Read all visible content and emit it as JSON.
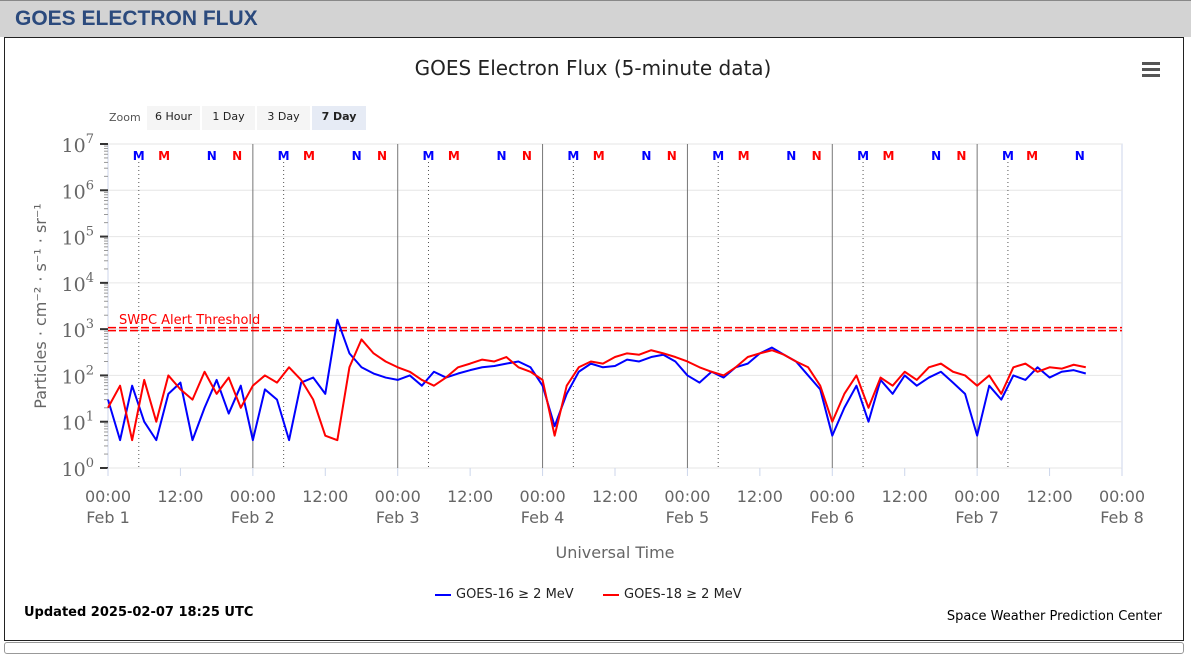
{
  "header": {
    "title": "GOES ELECTRON FLUX"
  },
  "zoom": {
    "label": "Zoom",
    "buttons": [
      "6 Hour",
      "1 Day",
      "3 Day",
      "7 Day"
    ],
    "selected": "7 Day"
  },
  "legend": [
    "GOES-16 ≥ 2 MeV",
    "GOES-18 ≥ 2 MeV"
  ],
  "footer": {
    "updated": "Updated 2025-02-07 18:25 UTC",
    "credit": "Space Weather Prediction Center"
  },
  "chart_data": {
    "type": "line",
    "title": "GOES Electron Flux (5-minute data)",
    "xlabel": "Universal Time",
    "ylabel": "Particles · cm⁻² · s⁻¹ · sr⁻¹",
    "yscale": "log",
    "ylim": [
      1,
      10000000
    ],
    "ytick_exponents": [
      0,
      1,
      2,
      3,
      4,
      5,
      6,
      7
    ],
    "xlim_hours": [
      0,
      168
    ],
    "xticks": [
      {
        "hour": 0,
        "time": "00:00",
        "date": "Feb 1"
      },
      {
        "hour": 12,
        "time": "12:00",
        "date": ""
      },
      {
        "hour": 24,
        "time": "00:00",
        "date": "Feb 2"
      },
      {
        "hour": 36,
        "time": "12:00",
        "date": ""
      },
      {
        "hour": 48,
        "time": "00:00",
        "date": "Feb 3"
      },
      {
        "hour": 60,
        "time": "12:00",
        "date": ""
      },
      {
        "hour": 72,
        "time": "00:00",
        "date": "Feb 4"
      },
      {
        "hour": 84,
        "time": "12:00",
        "date": ""
      },
      {
        "hour": 96,
        "time": "00:00",
        "date": "Feb 5"
      },
      {
        "hour": 108,
        "time": "12:00",
        "date": ""
      },
      {
        "hour": 120,
        "time": "00:00",
        "date": "Feb 6"
      },
      {
        "hour": 132,
        "time": "12:00",
        "date": ""
      },
      {
        "hour": 144,
        "time": "00:00",
        "date": "Feb 7"
      },
      {
        "hour": 156,
        "time": "12:00",
        "date": ""
      },
      {
        "hour": 168,
        "time": "00:00",
        "date": "Feb 8"
      }
    ],
    "threshold": {
      "label": "SWPC Alert Threshold",
      "value": 1000,
      "color": "#ff0000"
    },
    "step_hours": 2,
    "series": [
      {
        "name": "GOES-16 ≥ 2 MeV",
        "color": "#0000ff",
        "values": [
          30,
          4,
          60,
          10,
          4,
          40,
          70,
          4,
          20,
          80,
          15,
          60,
          4,
          50,
          30,
          4,
          70,
          90,
          40,
          1600,
          300,
          150,
          110,
          90,
          80,
          100,
          60,
          120,
          90,
          110,
          130,
          150,
          160,
          180,
          200,
          150,
          60,
          8,
          40,
          120,
          180,
          150,
          160,
          220,
          200,
          250,
          280,
          200,
          100,
          70,
          120,
          90,
          150,
          180,
          300,
          400,
          280,
          200,
          100,
          50,
          5,
          20,
          60,
          10,
          80,
          40,
          100,
          60,
          90,
          120,
          70,
          40,
          5,
          60,
          30,
          100,
          80,
          150,
          90,
          120,
          130,
          110
        ]
      },
      {
        "name": "GOES-18 ≥ 2 MeV",
        "color": "#ff0000",
        "values": [
          20,
          60,
          4,
          80,
          10,
          100,
          50,
          30,
          120,
          40,
          90,
          20,
          60,
          100,
          70,
          150,
          80,
          30,
          5,
          4,
          150,
          600,
          300,
          200,
          150,
          120,
          80,
          60,
          90,
          150,
          180,
          220,
          200,
          250,
          150,
          120,
          80,
          5,
          60,
          150,
          200,
          180,
          250,
          300,
          280,
          350,
          300,
          250,
          200,
          150,
          120,
          100,
          150,
          250,
          300,
          350,
          280,
          200,
          150,
          60,
          10,
          40,
          100,
          20,
          90,
          60,
          120,
          80,
          150,
          180,
          120,
          100,
          60,
          100,
          40,
          150,
          180,
          120,
          150,
          140,
          170,
          150
        ]
      }
    ],
    "markers": [
      {
        "label": "M",
        "sat": 0,
        "hour": 5.1
      },
      {
        "label": "M",
        "sat": 1,
        "hour": 9.3
      },
      {
        "label": "N",
        "sat": 0,
        "hour": 17.2
      },
      {
        "label": "N",
        "sat": 1,
        "hour": 21.4
      },
      {
        "label": "M",
        "sat": 0,
        "hour": 29.1
      },
      {
        "label": "M",
        "sat": 1,
        "hour": 33.3
      },
      {
        "label": "N",
        "sat": 0,
        "hour": 41.2
      },
      {
        "label": "N",
        "sat": 1,
        "hour": 45.4
      },
      {
        "label": "M",
        "sat": 0,
        "hour": 53.1
      },
      {
        "label": "M",
        "sat": 1,
        "hour": 57.3
      },
      {
        "label": "N",
        "sat": 0,
        "hour": 65.2
      },
      {
        "label": "N",
        "sat": 1,
        "hour": 69.4
      },
      {
        "label": "M",
        "sat": 0,
        "hour": 77.1
      },
      {
        "label": "M",
        "sat": 1,
        "hour": 81.3
      },
      {
        "label": "N",
        "sat": 0,
        "hour": 89.2
      },
      {
        "label": "N",
        "sat": 1,
        "hour": 93.4
      },
      {
        "label": "M",
        "sat": 0,
        "hour": 101.1
      },
      {
        "label": "M",
        "sat": 1,
        "hour": 105.3
      },
      {
        "label": "N",
        "sat": 0,
        "hour": 113.2
      },
      {
        "label": "N",
        "sat": 1,
        "hour": 117.4
      },
      {
        "label": "M",
        "sat": 0,
        "hour": 125.1
      },
      {
        "label": "M",
        "sat": 1,
        "hour": 129.3
      },
      {
        "label": "N",
        "sat": 0,
        "hour": 137.2
      },
      {
        "label": "N",
        "sat": 1,
        "hour": 141.4
      },
      {
        "label": "M",
        "sat": 0,
        "hour": 149.1
      },
      {
        "label": "M",
        "sat": 1,
        "hour": 153.1
      },
      {
        "label": "N",
        "sat": 0,
        "hour": 161.0
      }
    ]
  }
}
